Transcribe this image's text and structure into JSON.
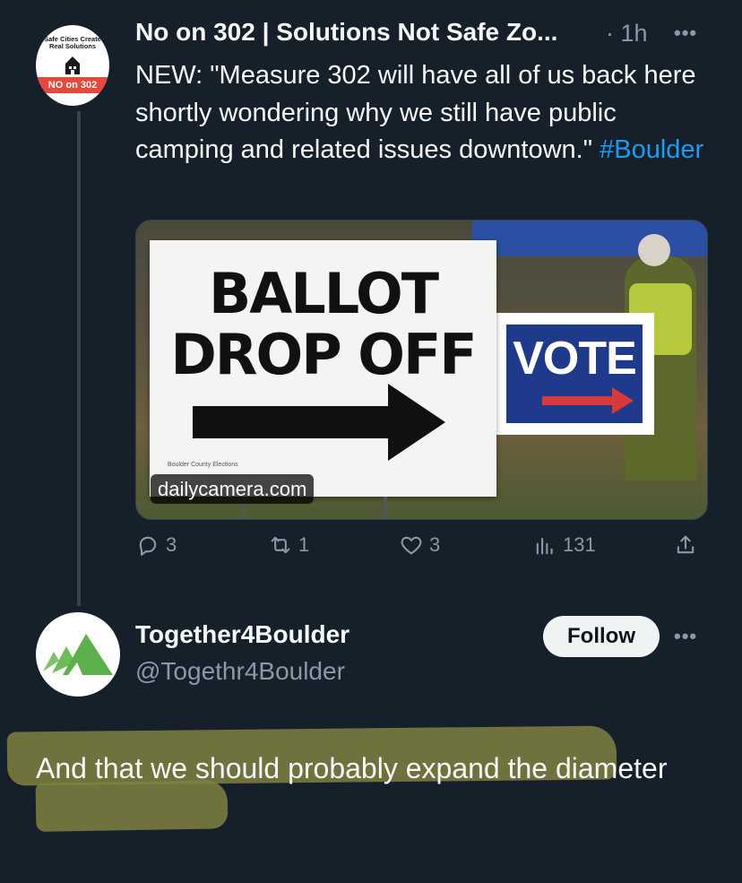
{
  "colors": {
    "background": "#15202b",
    "text": "#f7f9f9",
    "muted": "#8b98a5",
    "link": "#1d9bf0",
    "highlight": "#7f8140"
  },
  "tweet1": {
    "avatar": {
      "line1": "Safe Cities Create",
      "line2": "Real Solutions",
      "band_text": "NO on 302"
    },
    "display_name": "No on 302 | Solutions Not Safe Zo...",
    "time": "· 1h",
    "more_icon": "more-horizontal-icon",
    "text_main": "NEW: \"Measure 302 will have all of us back here shortly wondering why we still have public camping and related issues downtown.\" ",
    "hashtag": "#Boulder",
    "card": {
      "sign_line1": "BALLOT",
      "sign_line2": "DROP OFF",
      "sign_small": "Boulder County Elections",
      "vote_text": "VOTE",
      "domain": "dailycamera.com"
    },
    "actions": {
      "replies": "3",
      "reposts": "1",
      "likes": "3",
      "views": "131",
      "icons": [
        "reply-icon",
        "repost-icon",
        "like-icon",
        "views-icon",
        "share-icon"
      ]
    }
  },
  "tweet2": {
    "display_name": "Together4Boulder",
    "handle": "@Togethr4Boulder",
    "follow_label": "Follow",
    "more_icon": "more-horizontal-icon",
    "text": "And that we should probably expand the diameter"
  }
}
